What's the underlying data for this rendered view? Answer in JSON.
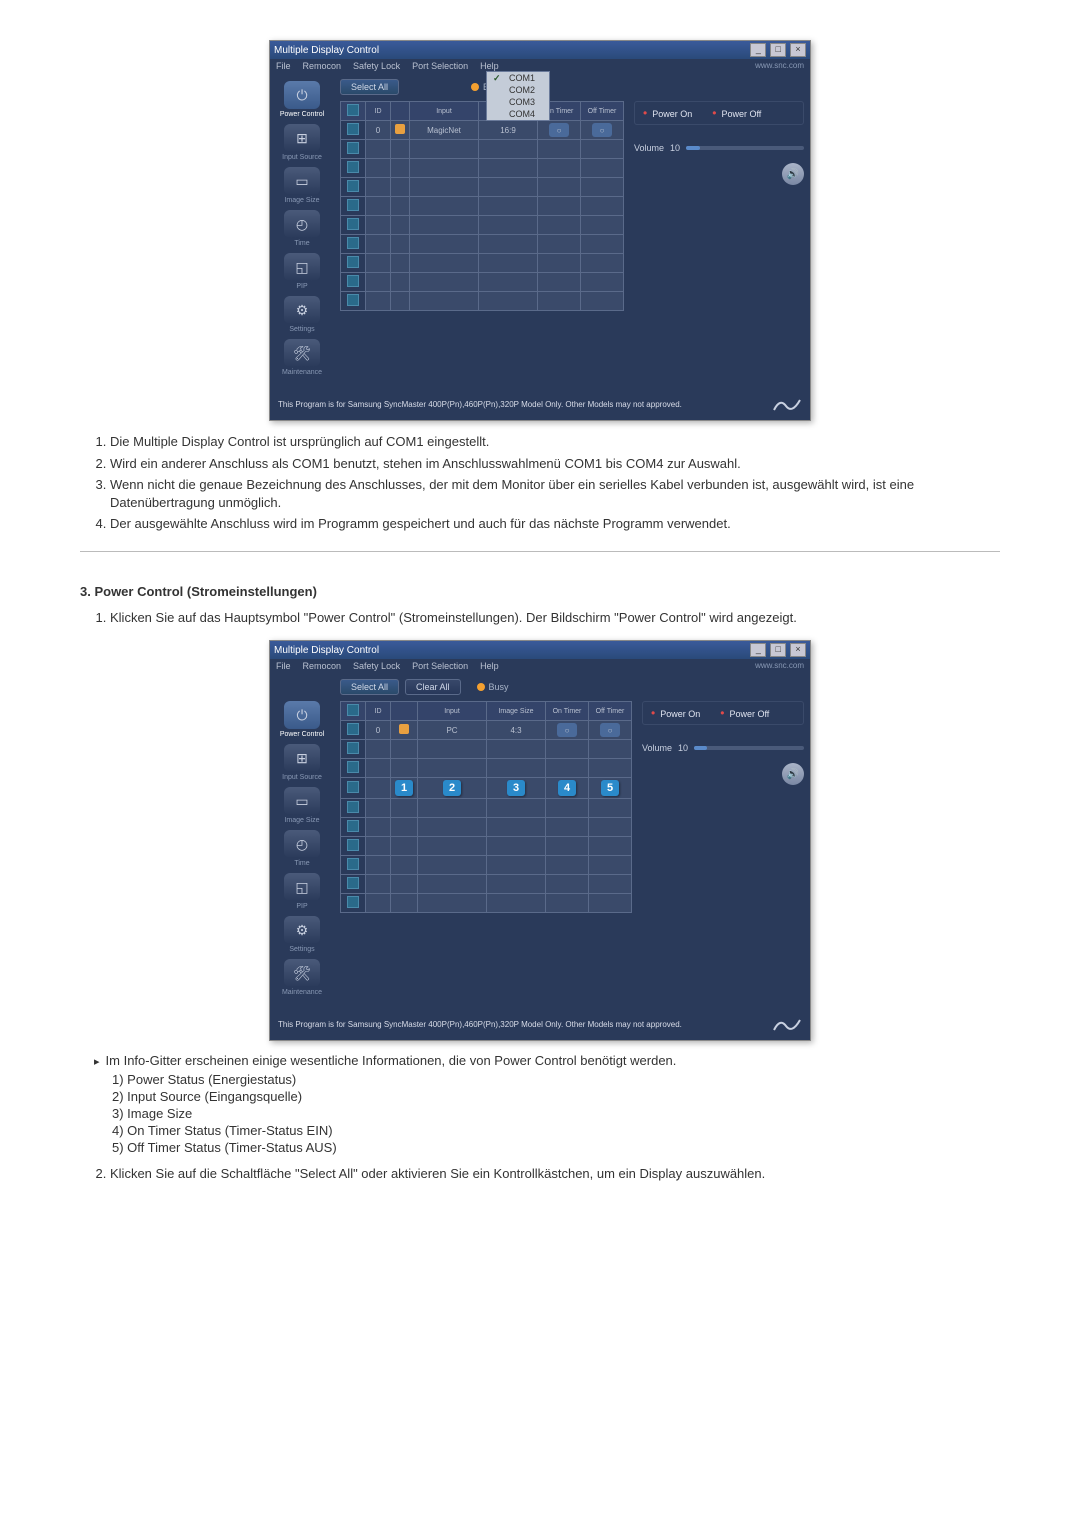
{
  "shot1": {
    "title": "Multiple Display Control",
    "menu": {
      "file": "File",
      "remocon": "Remocon",
      "safety": "Safety Lock",
      "port": "Port Selection",
      "help": "Help",
      "link": "www.snc.com"
    },
    "com": [
      "COM1",
      "COM2",
      "COM3",
      "COM4"
    ],
    "toolbar": {
      "select_all": "Select All",
      "clear_all": "Clear All",
      "busy": "Busy"
    },
    "cols": {
      "c1": "ID",
      "c2": "",
      "c3": "",
      "c4": "Input",
      "c5": "Image Size",
      "c6": "On Timer",
      "c7": "Off Timer"
    },
    "row0": {
      "id": "0",
      "input": "MagicNet",
      "size": "16:9",
      "on": "○",
      "off": "○"
    },
    "power_on": "Power On",
    "power_off": "Power Off",
    "volume": "Volume",
    "volume_val": "10",
    "disclaimer": "This Program is for Samsung SyncMaster 400P(Pn),460P(Pn),320P  Model Only. Other Models may not approved."
  },
  "sidebar": {
    "s1": "Power Control",
    "s2": "Input Source",
    "s3": "Image Size",
    "s4": "Time",
    "s5": "PIP",
    "s6": "Settings",
    "s7": "Maintenance"
  },
  "shot2": {
    "row0": {
      "id": "0",
      "input": "PC",
      "size": "4:3",
      "on": "○",
      "off": "○"
    }
  },
  "list1": {
    "i1": "Die Multiple Display Control ist ursprünglich auf COM1 eingestellt.",
    "i2": "Wird ein anderer Anschluss als COM1 benutzt, stehen im Anschlusswahlmenü COM1 bis COM4 zur Auswahl.",
    "i3": "Wenn nicht die genaue Bezeichnung des Anschlusses, der mit dem Monitor über ein serielles Kabel verbunden ist, ausgewählt wird, ist eine Datenübertragung unmöglich.",
    "i4": "Der ausgewählte Anschluss wird im Programm gespeichert und auch für das nächste Programm verwendet."
  },
  "sec3": {
    "heading": "3. Power Control (Stromeinstellungen)",
    "i1": "Klicken Sie auf das Hauptsymbol \"Power Control\" (Stromeinstellungen). Der Bildschirm \"Power Control\" wird angezeigt.",
    "info": "Im Info-Gitter erscheinen einige wesentliche Informationen, die von Power Control benötigt werden.",
    "g1": "1) Power Status (Energiestatus)",
    "g2": "2) Input Source (Eingangsquelle)",
    "g3": "3) Image Size",
    "g4": "4) On Timer Status (Timer-Status EIN)",
    "g5": "5) Off Timer Status (Timer-Status AUS)",
    "i2": "Klicken Sie auf die Schaltfläche \"Select All\" oder aktivieren Sie ein Kontrollkästchen, um ein Display auszuwählen."
  }
}
